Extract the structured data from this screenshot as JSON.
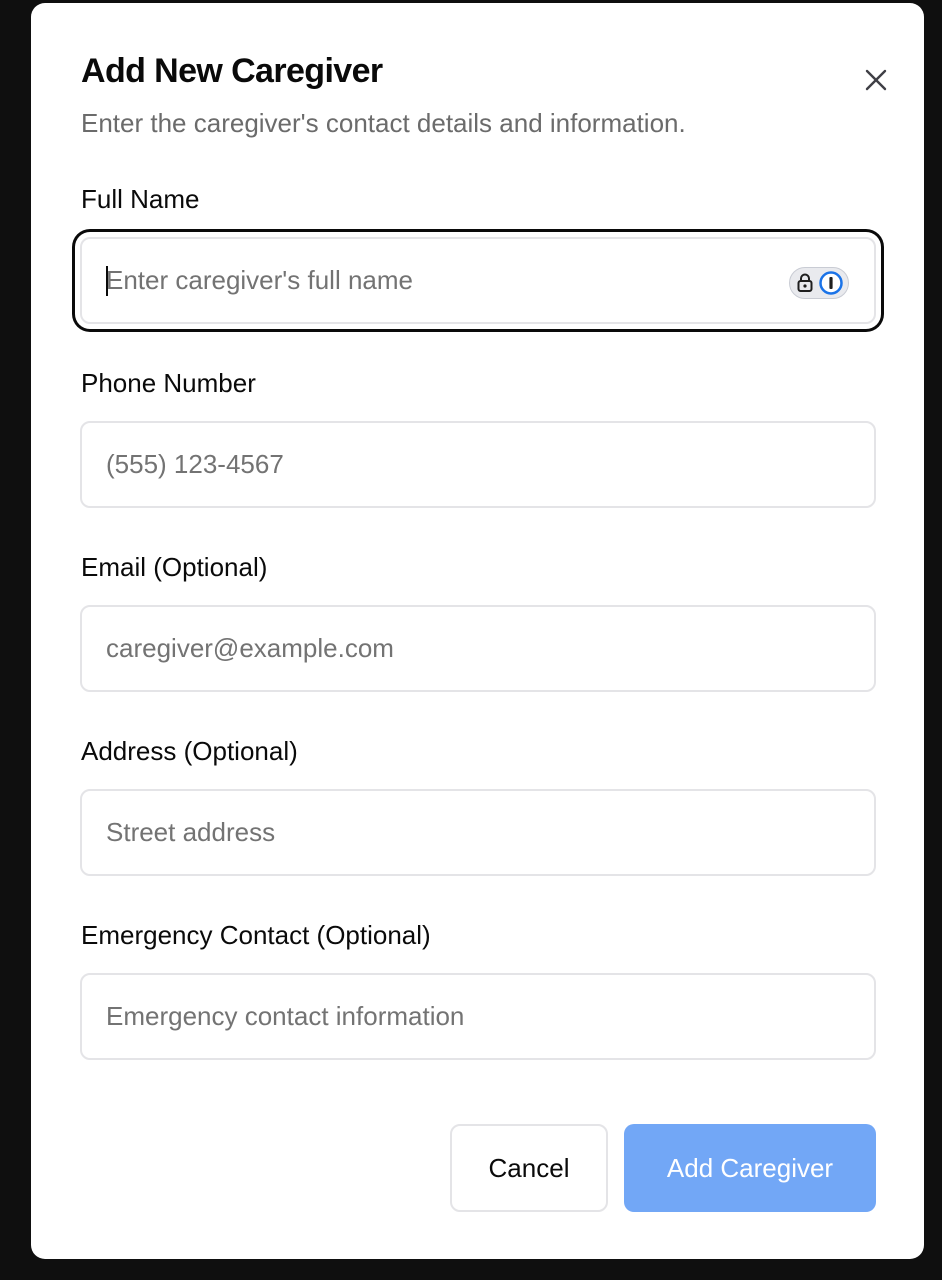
{
  "dialog": {
    "title": "Add New Caregiver",
    "subtitle": "Enter the caregiver's contact details and information.",
    "close_icon": "close-icon"
  },
  "fields": {
    "full_name": {
      "label": "Full Name",
      "placeholder": "Enter caregiver's full name",
      "value": "",
      "focused": true,
      "extension_icon": "password-manager-icon"
    },
    "phone": {
      "label": "Phone Number",
      "placeholder": "(555) 123-4567",
      "value": ""
    },
    "email": {
      "label": "Email (Optional)",
      "placeholder": "caregiver@example.com",
      "value": ""
    },
    "address": {
      "label": "Address (Optional)",
      "placeholder": "Street address",
      "value": ""
    },
    "emergency": {
      "label": "Emergency Contact (Optional)",
      "placeholder": "Emergency contact information",
      "value": ""
    }
  },
  "actions": {
    "cancel_label": "Cancel",
    "submit_label": "Add Caregiver"
  },
  "colors": {
    "primary": "#72a7f6",
    "focus_ring": "#0a0a0a",
    "backdrop": "#0f0f0f"
  }
}
